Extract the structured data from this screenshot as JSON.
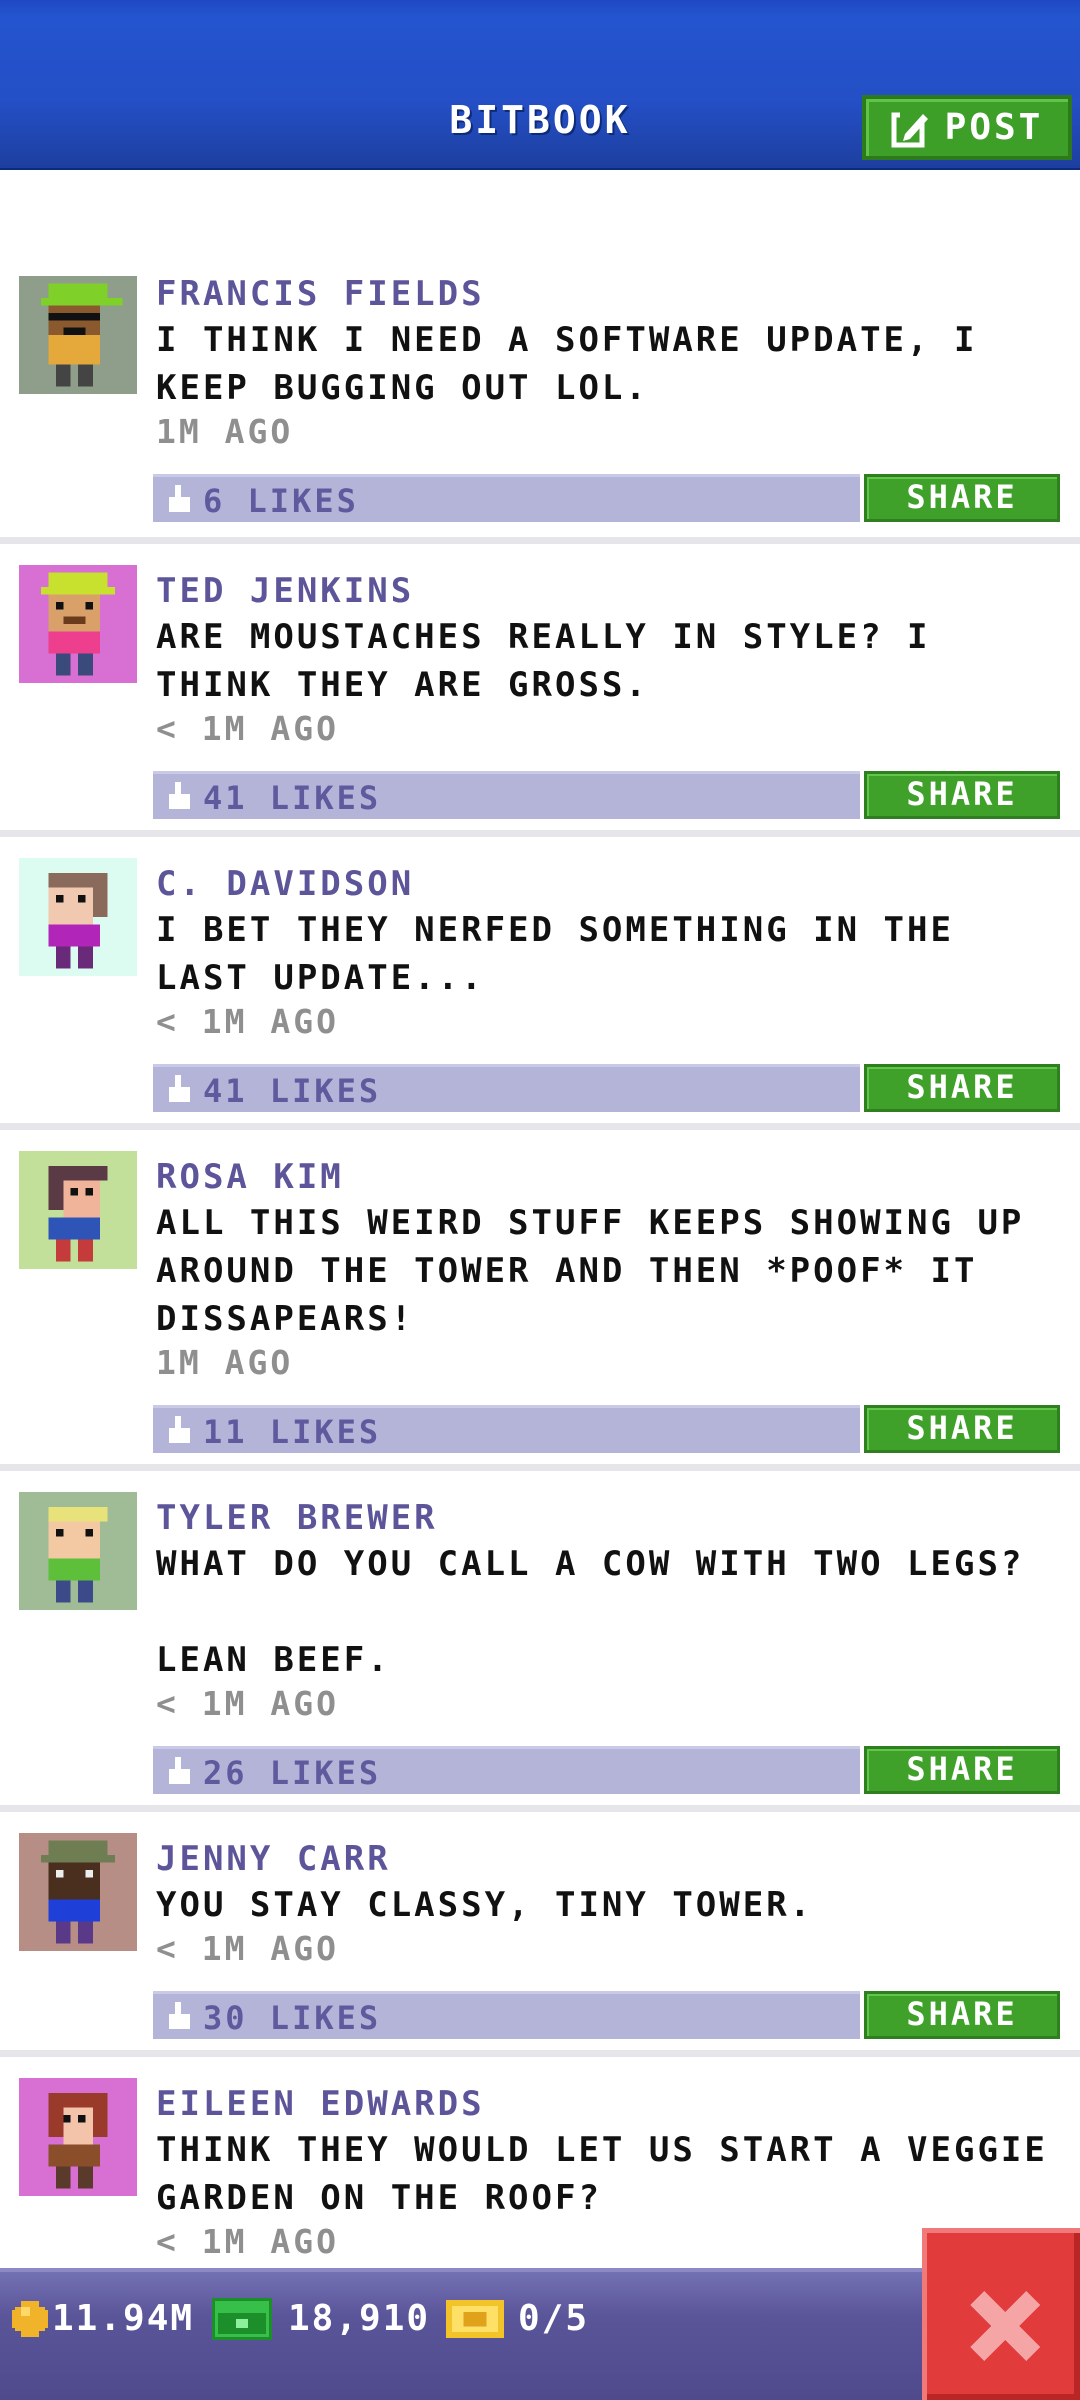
{
  "header": {
    "title": "BITBOOK",
    "post_label": "POST",
    "colors": {
      "bar": "#244fc6",
      "post_button": "#3d9f27"
    }
  },
  "posts": [
    {
      "name": "FRANCIS FIELDS",
      "text": "I THINK I NEED A SOFTWARE UPDATE, I KEEP BUGGING OUT LOL.",
      "time": "1M AGO",
      "likes": "6 LIKES",
      "share": "SHARE",
      "avatar": "avatar-francis-sunglasses-cap"
    },
    {
      "name": "TED JENKINS",
      "text": "ARE MOUSTACHES REALLY IN STYLE? I THINK THEY ARE GROSS.",
      "time": "< 1M AGO",
      "likes": "41 LIKES",
      "share": "SHARE",
      "avatar": "avatar-ted-cap"
    },
    {
      "name": "C. DAVIDSON",
      "text": "I BET THEY NERFED SOMETHING IN THE LAST UPDATE...",
      "time": "< 1M AGO",
      "likes": "41 LIKES",
      "share": "SHARE",
      "avatar": "avatar-davidson"
    },
    {
      "name": "ROSA KIM",
      "text": "ALL THIS WEIRD STUFF KEEPS SHOWING UP AROUND THE TOWER AND THEN *POOF* IT DISSAPEARS!",
      "time": "1M AGO",
      "likes": "11 LIKES",
      "share": "SHARE",
      "avatar": "avatar-rosa"
    },
    {
      "name": "TYLER BREWER",
      "text": "WHAT DO YOU CALL A COW WITH TWO LEGS?\n\nLEAN BEEF.",
      "time": "< 1M AGO",
      "likes": "26 LIKES",
      "share": "SHARE",
      "avatar": "avatar-tyler"
    },
    {
      "name": "JENNY CARR",
      "text": "YOU STAY CLASSY, TINY TOWER.",
      "time": "< 1M AGO",
      "likes": "30 LIKES",
      "share": "SHARE",
      "avatar": "avatar-jenny-hat"
    },
    {
      "name": "EILEEN EDWARDS",
      "text": "THINK THEY WOULD LET US START A VEGGIE GARDEN ON THE ROOF?",
      "time": "< 1M AGO",
      "likes": "",
      "share": "",
      "avatar": "avatar-eileen"
    }
  ],
  "status": {
    "coins": "11.94M",
    "bux": "18,910",
    "tickets": "0/5",
    "icons": [
      "coin-icon",
      "bux-icon",
      "ticket-icon",
      "close-icon"
    ],
    "colors": {
      "bar": "#5a5599",
      "close": "#e23b3b"
    }
  }
}
